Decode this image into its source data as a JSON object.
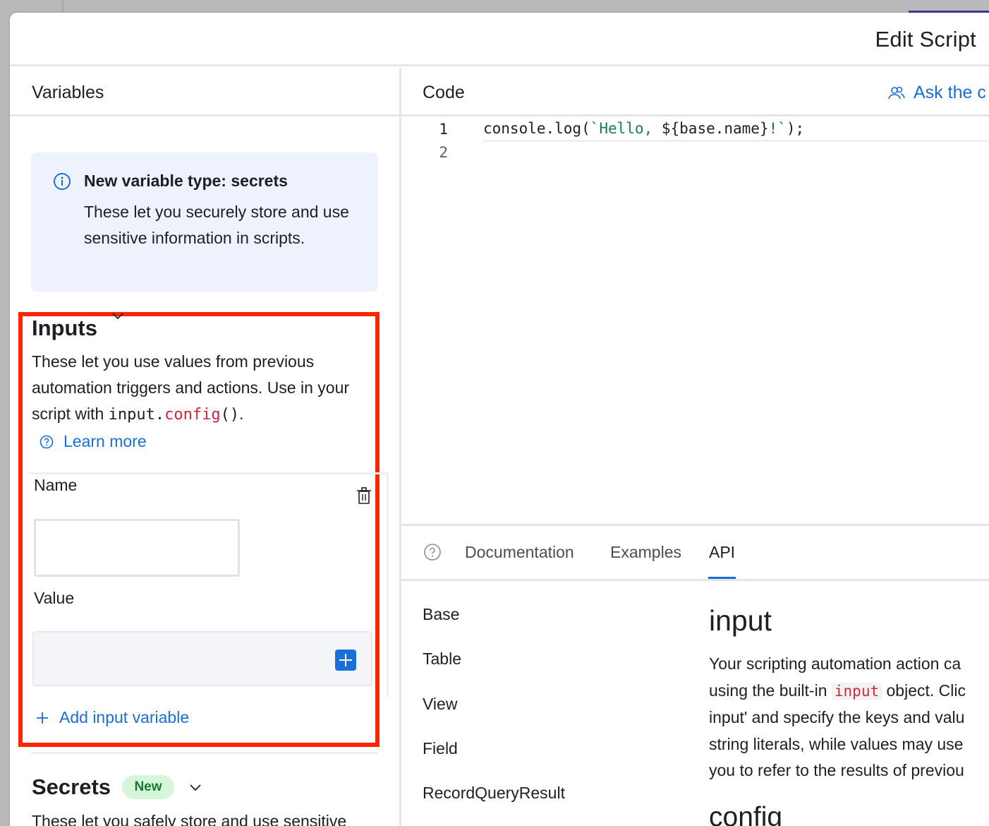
{
  "dialog": {
    "title": "Edit Script"
  },
  "variables": {
    "header": "Variables",
    "info": {
      "title": "New variable type: secrets",
      "body": "These let you securely store and use sensitive information in scripts."
    },
    "inputs": {
      "title": "Inputs",
      "desc_prefix": "These let you use values from previous automation triggers and actions. Use in your script with ",
      "code_obj": "input.",
      "code_fn": "config",
      "code_parens": "()",
      "desc_suffix": ".",
      "learn_more": "Learn more",
      "name_label": "Name",
      "name_value": "",
      "value_label": "Value",
      "value_value": "",
      "add_label": "Add input variable"
    },
    "secrets": {
      "title": "Secrets",
      "badge": "New",
      "desc": "These let you safely store and use sensitive"
    }
  },
  "code": {
    "header": "Code",
    "ask_label": "Ask the c",
    "line_numbers": [
      "1",
      "2"
    ],
    "line1": {
      "prefix": "console.log(",
      "string": "`Hello, ",
      "interp": "${base.name}",
      "string_end": "!`",
      "suffix": ");"
    }
  },
  "docs": {
    "tabs": [
      "Documentation",
      "Examples",
      "API"
    ],
    "active_tab": "API",
    "nav": [
      "Base",
      "Table",
      "View",
      "Field",
      "RecordQueryResult"
    ],
    "heading": "input",
    "para": {
      "line1": "Your scripting automation action ca",
      "line2_prefix": "using the built-in ",
      "line2_code": "input",
      "line2_suffix": " object. Clic",
      "line3": "input' and specify the keys and valu",
      "line4": "string literals, while values may use",
      "line5": "you to refer to the results of previou"
    },
    "subheading": "config"
  },
  "colors": {
    "accent": "#1a6fd6",
    "highlight_border": "#ff2400",
    "badge_bg": "#d7f5d9",
    "badge_text": "#157a33"
  }
}
